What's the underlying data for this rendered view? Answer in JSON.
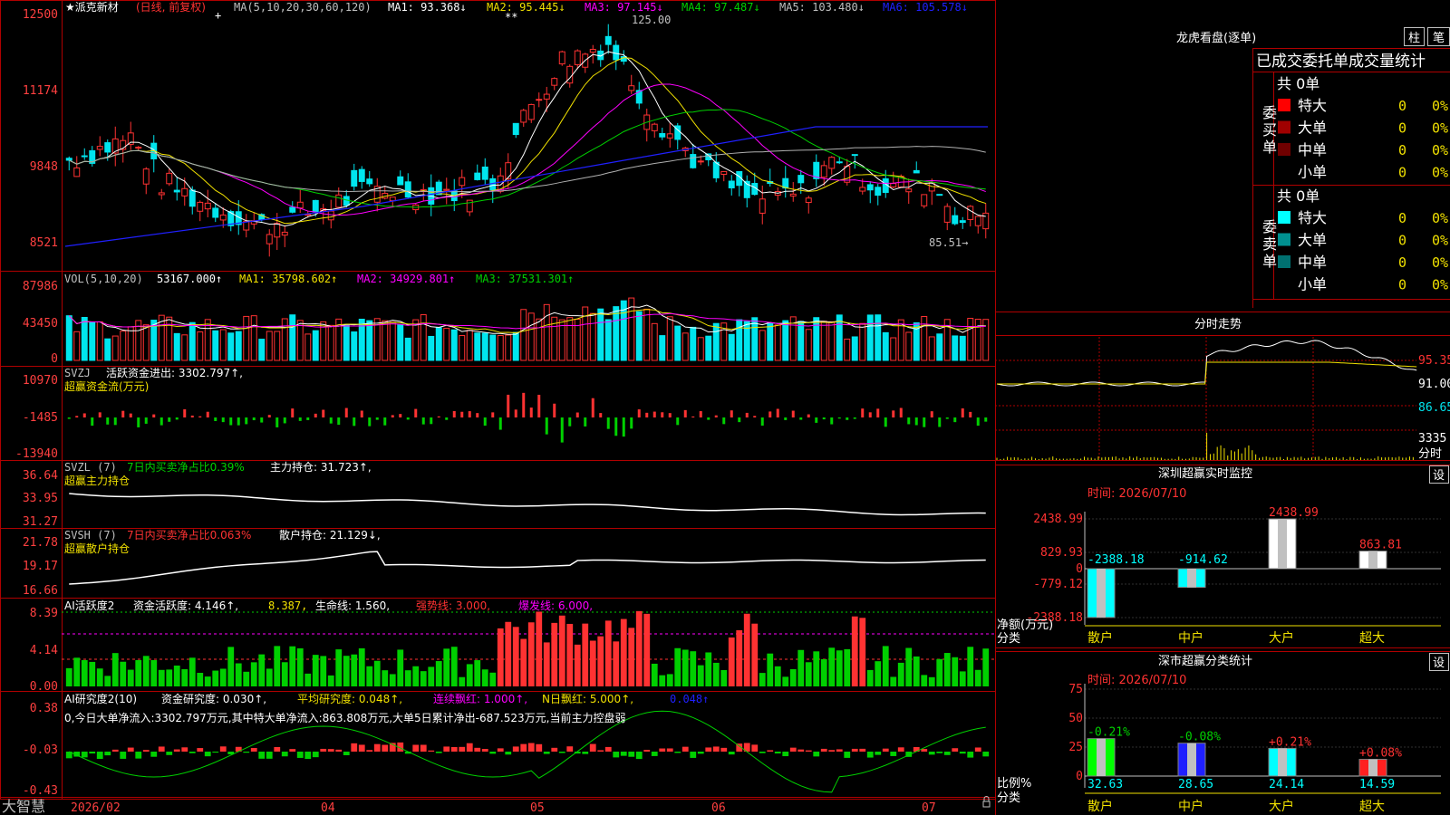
{
  "app": {
    "brand": "大智慧"
  },
  "colors": {
    "up": "#ff3232",
    "down": "#00e5ee",
    "green": "#00d000",
    "yellow": "#f0e000",
    "magenta": "#ff00ff",
    "white": "#ffffff",
    "grid": "#b00000",
    "blue": "#2020ff",
    "gray": "#b0b0b0",
    "axis_red": "#ff4040"
  },
  "kline": {
    "stock_title": "★派克新材",
    "period": "(日线, 前复权)",
    "ma_params": "MA(5,10,20,30,60,120)",
    "ma1": "MA1: 93.368↓",
    "ma2": "MA2: 95.445↓",
    "ma3": "MA3: 97.145↓",
    "ma4": "MA4: 97.487↓",
    "ma5": "MA5: 103.480↓",
    "ma6": "MA6: 105.578↓",
    "high_label": "125.00",
    "low_label": "85.51→",
    "y_ticks": [
      "12500",
      "11174",
      "9848",
      "8521"
    ]
  },
  "vol": {
    "title": "VOL(5,10,20)",
    "value": "53167.000↑",
    "ma1": "MA1: 35798.602↑",
    "ma2": "MA2: 34929.801↑",
    "ma3": "MA3: 37531.301↑",
    "y_ticks": [
      "87986",
      "43450",
      "0"
    ]
  },
  "svzj": {
    "title": "SVZJ",
    "item": "活跃资金进出: 3302.797↑,",
    "sub": "超赢资金流(万元)",
    "y_ticks": [
      "10970",
      "-1485",
      "-13940"
    ]
  },
  "svzl": {
    "title": "SVZL (7)",
    "ratio": "7日内买卖净占比0.39%",
    "hold": "主力持仓: 31.723↑,",
    "sub": "超赢主力持仓",
    "y_ticks": [
      "36.64",
      "33.95",
      "31.27"
    ]
  },
  "svsh": {
    "title": "SVSH (7)",
    "ratio": "7日内买卖净占比0.063%",
    "hold": "散户持仓: 21.129↓,",
    "sub": "超赢散户持仓",
    "y_ticks": [
      "21.78",
      "19.17",
      "16.66"
    ]
  },
  "ai_active": {
    "title": "AI活跃度2",
    "active": "资金活跃度: 4.146↑,",
    "val2": "8.387,",
    "life": "生命线: 1.560,",
    "strong": "强势线: 3.000,",
    "burst": "爆发线: 6.000,",
    "y_ticks": [
      "8.39",
      "4.14",
      "0.00"
    ]
  },
  "ai_research": {
    "title": "AI研究度2(10)",
    "research": "资金研究度: 0.030↑,",
    "avg": "平均研究度: 0.048↑,",
    "lianxu": "连续飘红: 1.000↑,",
    "nri": "N日飘红: 5.000↑,",
    "last": "0.048↑",
    "summary": "0,今日大单净流入:3302.797万元,其中特大单净流入:863.808万元,大单5日累计净出-687.523万元,当前主力控盘弱",
    "y_ticks": [
      "0.38",
      "-0.03",
      "-0.43"
    ]
  },
  "xaxis": {
    "labels": [
      "2026/02",
      "04",
      "05",
      "06",
      "07"
    ]
  },
  "lhb": {
    "title": "龙虎看盘(逐单)",
    "tab_zhu": "柱",
    "tab_bi": "笔",
    "section_title": "已成交委托单成交量统计",
    "buy_label": "委买单",
    "sell_label": "委卖单",
    "buy_total": "共 0单",
    "sell_total": "共 0单",
    "buy_rows": [
      {
        "name": "特大",
        "count": "0",
        "pct": "0%",
        "color": "#ff0000"
      },
      {
        "name": "大单",
        "count": "0",
        "pct": "0%",
        "color": "#a00000"
      },
      {
        "name": "中单",
        "count": "0",
        "pct": "0%",
        "color": "#700000"
      },
      {
        "name": "小单",
        "count": "0",
        "pct": "0%",
        "color": ""
      }
    ],
    "sell_rows": [
      {
        "name": "特大",
        "count": "0",
        "pct": "0%",
        "color": "#00ffff"
      },
      {
        "name": "大单",
        "count": "0",
        "pct": "0%",
        "color": "#009090"
      },
      {
        "name": "中单",
        "count": "0",
        "pct": "0%",
        "color": "#007070"
      },
      {
        "name": "小单",
        "count": "0",
        "pct": "0%",
        "color": ""
      }
    ]
  },
  "intraday": {
    "title": "分时走势",
    "price_ticks": [
      "95.35",
      "91.00",
      "86.65"
    ],
    "vol_tick": "3335",
    "vol_label": "分时"
  },
  "sz_monitor": {
    "title": "深圳超赢实时监控",
    "btn": "设",
    "time": "时间: 2026/07/10",
    "y_ticks": [
      "2438.99",
      "829.93",
      "0",
      "-779.12",
      "-2388.18"
    ],
    "y_label": "净额(万元)",
    "x_label": "分类",
    "bars": [
      {
        "name": "散户",
        "value": -2388.18,
        "label": "-2388.18",
        "color": "#00ffff"
      },
      {
        "name": "中户",
        "value": -914.62,
        "label": "-914.62",
        "color": "#00ffff"
      },
      {
        "name": "大户",
        "value": 2438.99,
        "label": "2438.99",
        "color": "#ffffff"
      },
      {
        "name": "超大",
        "value": 863.81,
        "label": "863.81",
        "color": "#ffffff"
      }
    ]
  },
  "sz_category": {
    "title": "深市超赢分类统计",
    "btn": "设",
    "time": "时间: 2026/07/10",
    "y_ticks": [
      "75",
      "50",
      "25",
      "0"
    ],
    "y_label": "比例%",
    "x_label": "分类",
    "bars": [
      {
        "name": "散户",
        "value": 32.63,
        "label": "32.63",
        "change": "-0.21%",
        "color": "#00ff00"
      },
      {
        "name": "中户",
        "value": 28.65,
        "label": "28.65",
        "change": "-0.08%",
        "color": "#2020ff"
      },
      {
        "name": "大户",
        "value": 24.14,
        "label": "24.14",
        "change": "+0.21%",
        "color": "#00ffff"
      },
      {
        "name": "超大",
        "value": 14.59,
        "label": "14.59",
        "change": "+0.08%",
        "color": "#ff2020"
      }
    ]
  }
}
